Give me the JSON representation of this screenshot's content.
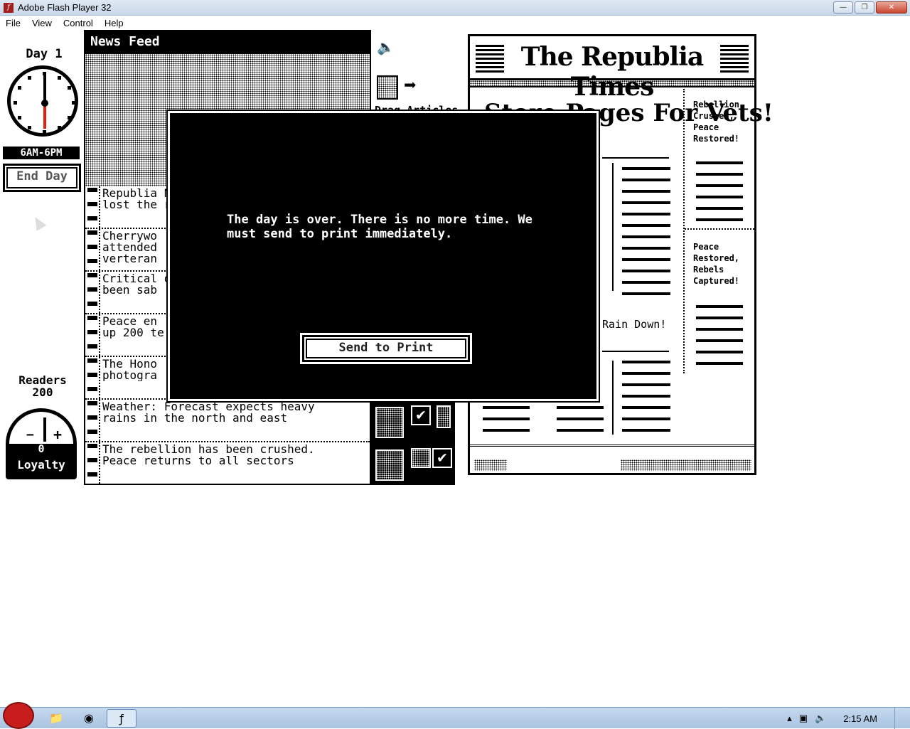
{
  "window": {
    "title": "Adobe Flash Player 32",
    "controls": [
      "minimize",
      "restore",
      "close"
    ]
  },
  "menu": [
    "File",
    "View",
    "Control",
    "Help"
  ],
  "left_panel": {
    "day_label": "Day 1",
    "shift_label": "6AM-6PM",
    "end_day_label": "End Day",
    "readers_label": "Readers",
    "readers_value": "200",
    "loyalty_value": "0",
    "loyalty_label": "Loyalty",
    "loyalty_minus": "−",
    "loyalty_plus": "+"
  },
  "feed": {
    "title": "News Feed",
    "items": [
      "Republia N\nlost the r",
      "Cherrywo\nattended\nverteran",
      "Critical oi\nbeen sab",
      "Peace en\nup 200 te",
      "The Hono\nphotogra",
      "Weather: Forecast expects heavy\nrains in the north and east",
      "The rebellion has been crushed.\nPeace returns to all sectors"
    ]
  },
  "controls": {
    "speaker_icon": "speaker-icon",
    "drag_label": "Drag Articles"
  },
  "newspaper": {
    "name": "The Republia Times",
    "headline": "Store Pages For Vets!",
    "side_story_1": "Rebellion\nCrushed,\nPeace\nRestored!",
    "side_story_2": "Peace\nRestored,\nRebels\nCaptured!",
    "rain_headline": "Rain Down!"
  },
  "modal": {
    "message": "The day is over. There is no more time. We must send to print immediately.",
    "button_label": "Send to Print"
  },
  "taskbar": {
    "time": "2:15 AM",
    "apps": [
      "angry-birds-start-icon",
      "folder-icon",
      "chrome-icon",
      "flash-player-icon"
    ]
  }
}
